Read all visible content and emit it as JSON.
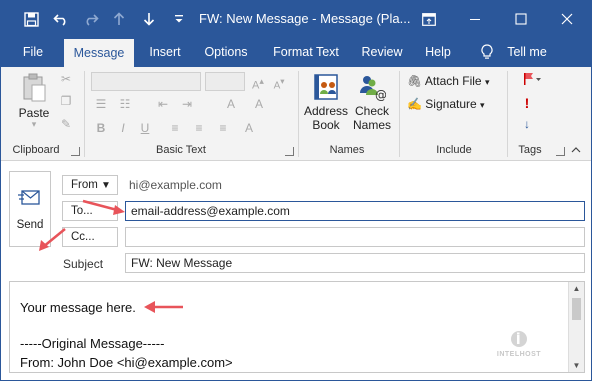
{
  "window": {
    "title": "FW: New Message  -  Message (Pla...",
    "restore_icon": "ribbon-display-icon",
    "minimize_icon": "minimize-icon",
    "maximize_icon": "maximize-icon",
    "close_icon": "close-icon"
  },
  "quick_access": [
    "save-icon",
    "undo-icon",
    "redo-icon",
    "up-arrow-icon",
    "down-arrow-icon",
    "customize-icon"
  ],
  "tabs": [
    {
      "label": "File"
    },
    {
      "label": "Message"
    },
    {
      "label": "Insert"
    },
    {
      "label": "Options"
    },
    {
      "label": "Format Text"
    },
    {
      "label": "Review"
    },
    {
      "label": "Help"
    },
    {
      "label": "Tell me"
    }
  ],
  "ribbon": {
    "clipboard": {
      "label": "Clipboard",
      "paste": "Paste"
    },
    "basic_text": {
      "label": "Basic Text"
    },
    "names": {
      "label": "Names",
      "address_book_1": "Address",
      "address_book_2": "Book",
      "check_names_1": "Check",
      "check_names_2": "Names"
    },
    "include": {
      "label": "Include",
      "attach_file": "Attach File",
      "signature": "Signature"
    },
    "tags": {
      "label": "Tags"
    }
  },
  "compose": {
    "send": "Send",
    "from_button": "From",
    "from_value": "hi@example.com",
    "to_button": "To...",
    "to_value": "email-address@example.com",
    "cc_button": "Cc...",
    "cc_value": "",
    "subject_label": "Subject",
    "subject_value": "FW: New Message"
  },
  "message": {
    "line1": "Your message here.",
    "line2": "-----Original Message-----",
    "line3": "From: John Doe <hi@example.com>",
    "watermark": "INTELHOST"
  },
  "colors": {
    "accent": "#2b579a",
    "annotation_arrow": "#e8545a"
  }
}
